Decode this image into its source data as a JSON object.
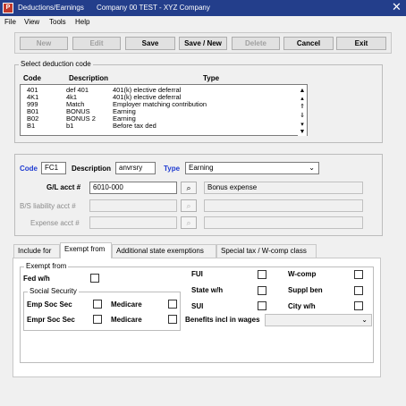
{
  "window": {
    "title": "Deductions/Earnings",
    "company": "Company 00  TEST - XYZ Company",
    "close_glyph": "✕"
  },
  "menu": {
    "items": [
      {
        "label": "File"
      },
      {
        "label": "View"
      },
      {
        "label": "Tools"
      },
      {
        "label": "Help"
      }
    ]
  },
  "toolbar": {
    "new": "New",
    "edit": "Edit",
    "save": "Save",
    "save_new": "Save / New",
    "delete": "Delete",
    "cancel": "Cancel",
    "exit": "Exit"
  },
  "select_group": {
    "label": "Select deduction code",
    "headers": {
      "code": "Code",
      "description": "Description",
      "type": "Type"
    },
    "rows": [
      {
        "code": "401",
        "description": "def 401",
        "type": "401(k) elective deferral"
      },
      {
        "code": "4K1",
        "description": "4k1",
        "type": "401(k) elective deferral"
      },
      {
        "code": "999",
        "description": "Match",
        "type": "Employer matching contribution"
      },
      {
        "code": "B01",
        "description": "BONUS",
        "type": "Earning"
      },
      {
        "code": "B02",
        "description": "BONUS 2",
        "type": "Earning"
      },
      {
        "code": "B1",
        "description": "b1",
        "type": "Before tax ded"
      }
    ]
  },
  "detail": {
    "code_label": "Code",
    "code_value": "FC1",
    "description_label": "Description",
    "description_value": "anvrsry",
    "type_label": "Type",
    "type_value": "Earning",
    "gl_acct_label": "G/L acct #",
    "gl_acct_value": "6010-000",
    "gl_acct_desc": "Bonus expense",
    "bs_liability_label": "B/S liability acct #",
    "bs_liability_value": "",
    "expense_acct_label": "Expense acct #",
    "expense_acct_value": ""
  },
  "tabs": [
    {
      "label": "Include for"
    },
    {
      "label": "Exempt from"
    },
    {
      "label": "Additional state exemptions"
    },
    {
      "label": "Special tax / W-comp class"
    }
  ],
  "exempt": {
    "group_label": "Exempt from",
    "fed_wh": "Fed w/h",
    "social_security_label": "Social Security",
    "emp_soc_sec": "Emp Soc Sec",
    "empr_soc_sec": "Empr Soc Sec",
    "medicare_1": "Medicare",
    "medicare_2": "Medicare",
    "fui": "FUI",
    "state_wh": "State w/h",
    "sui": "SUI",
    "wcomp": "W-comp",
    "suppl_ben": "Suppl ben",
    "city_wh": "City w/h",
    "benefits_incl": "Benefits incl in wages",
    "benefits_value": ""
  },
  "colors": {
    "titlebar": "#233e8b",
    "label_blue": "#1f3bd1"
  }
}
